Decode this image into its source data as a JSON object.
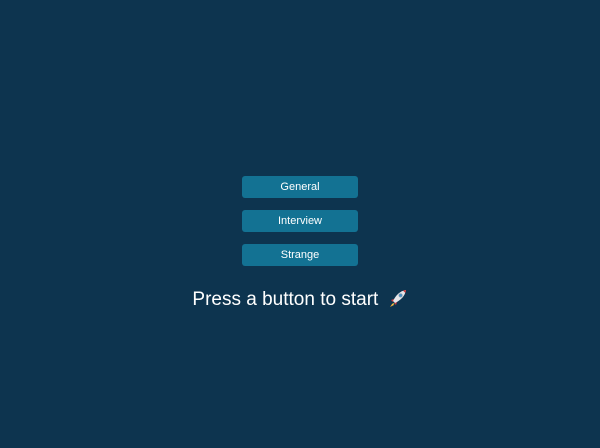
{
  "menu": {
    "buttons": [
      {
        "label": "General"
      },
      {
        "label": "Interview"
      },
      {
        "label": "Strange"
      }
    ]
  },
  "prompt": {
    "text": "Press a button to start",
    "icon": "rocket-icon"
  },
  "colors": {
    "background": "#0d344f",
    "button": "#137293",
    "text": "#ffffff"
  }
}
